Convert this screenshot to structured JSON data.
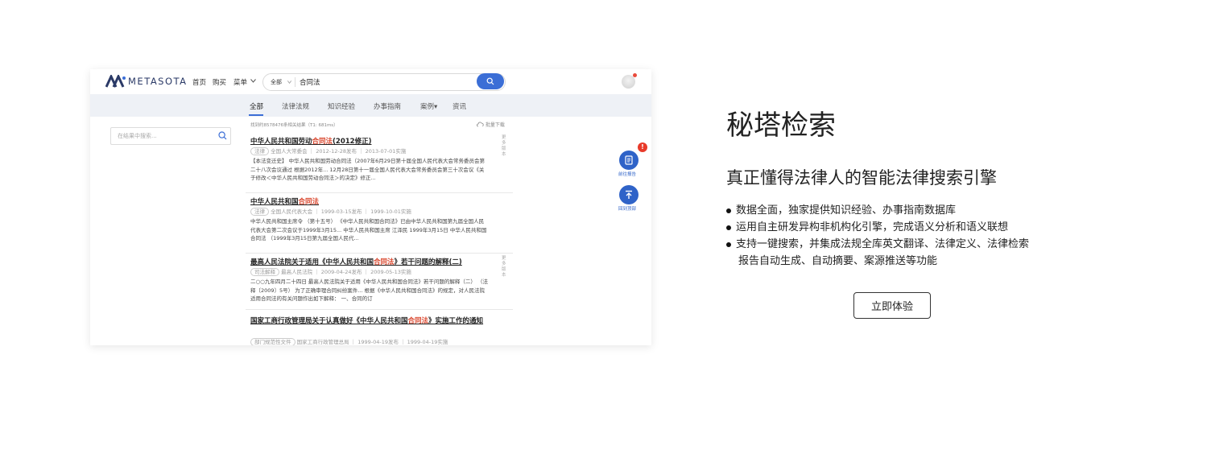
{
  "app": {
    "brand": "METASOTA",
    "nav": [
      "首页",
      "购买",
      "菜单"
    ],
    "menu_chevron_icon": "chevron-down-icon",
    "search": {
      "scope": "全部",
      "query": "合同法",
      "button_icon": "search-icon"
    },
    "tabs": [
      "全部",
      "法律法规",
      "知识经验",
      "办事指南",
      "案例▾",
      "资讯"
    ],
    "active_tab": "全部",
    "filter_placeholder": "在结果中搜索...",
    "stats": "找到约8578476条相关结果（T1: 681ms）",
    "batch_download": "批量下载",
    "more_label": "更多版本",
    "results": [
      {
        "title_pre": "中华人民共和国劳动",
        "title_hl": "合同法",
        "title_post": "(2012修正)",
        "tag": "法律",
        "meta": "全国人大常委会 ｜ 2012-12-28发布 ｜ 2013-07-01实施",
        "snippet": "【本法变迁史】 中华人民共和国劳动合同法（2007年6月29日第十届全国人民代表大会常务委员会第二十八次会议通过 根据2012年... 12月28日第十一届全国人民代表大会常务委员会第三十次会议《关于修改＜中华人民共和国劳动合同法＞的决定》修正..."
      },
      {
        "title_pre": "中华人民共和国",
        "title_hl": "合同法",
        "title_post": "",
        "tag": "法律",
        "meta": "全国人民代表大会 ｜ 1999-03-15发布 ｜ 1999-10-01实施",
        "snippet": "中华人民共和国主席令 （第十五号） 《中华人民共和国合同法》已由中华人民共和国第九届全国人民代表大会第二次会议于1999年3月15... 中华人民共和国主席 江泽民 1999年3月15日 中华人民共和国合同法 （1999年3月15日第九届全国人民代..."
      },
      {
        "title_pre": "最高人民法院关于适用《中华人民共和国",
        "title_hl": "合同法",
        "title_post": "》若干问题的解释(二)",
        "tag": "司法解释",
        "meta": "最高人民法院 ｜ 2009-04-24发布 ｜ 2009-05-13实施",
        "snippet": "二○○九年四月二十四日 最高人民法院关于适用《中华人民共和国合同法》若干问题的解释（二） （法释〔2009〕5号） 为了正确审理合同纠纷案件... 根据《中华人民共和国合同法》的规定，对人民法院适用合同法的有关问题作出如下解释： 一、合同的订"
      },
      {
        "title_pre": "国家工商行政管理局关于认真做好《中华人民共和国",
        "title_hl": "合同法",
        "title_post": "》实施工作的通知",
        "tag": "部门规范性文件",
        "meta": "国家工商行政管理总局 ｜ 1999-04-19发布 ｜ 1999-04-19实施",
        "snippet": ""
      }
    ],
    "side_buttons": [
      {
        "label": "前往报告",
        "icon": "report-icon",
        "badge": "!"
      },
      {
        "label": "回到顶部",
        "icon": "back-to-top-icon"
      }
    ],
    "colors": {
      "accent": "#3b6ed6",
      "highlight": "#d9452c",
      "badge": "#e83a2a"
    }
  },
  "promo": {
    "title": "秘塔检索",
    "subtitle": "真正懂得法律人的智能法律搜索引擎",
    "bullets": [
      "数据全面，独家提供知识经验、办事指南数据库",
      "运用自主研发异构非机构化引擎，完成语义分析和语义联想",
      "支持一键搜索，并集成法规全库英文翻译、法律定义、法律检索"
    ],
    "bullet_continuation": "报告自动生成、自动摘要、案源推送等功能",
    "cta": "立即体验"
  }
}
